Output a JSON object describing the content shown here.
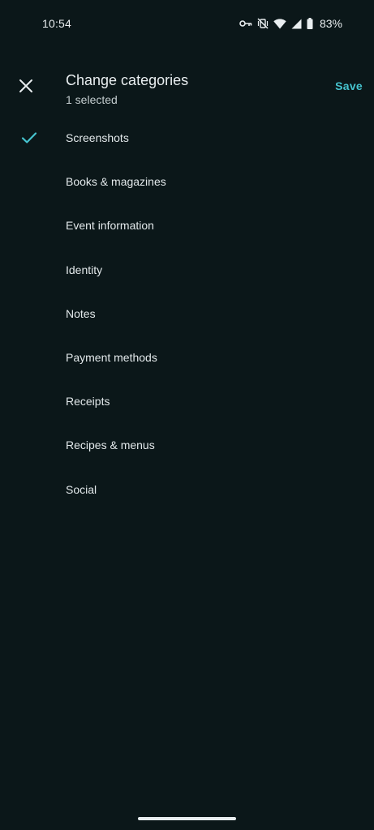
{
  "status_bar": {
    "time": "10:54",
    "battery_percent": "83%",
    "icons": [
      "key-icon",
      "vibrate-off-icon",
      "wifi-icon",
      "signal-icon",
      "battery-icon"
    ]
  },
  "header": {
    "close_icon": "close-icon",
    "title": "Change categories",
    "subtitle": "1 selected",
    "save_label": "Save"
  },
  "categories": [
    {
      "label": "Screenshots",
      "selected": true
    },
    {
      "label": "Books & magazines",
      "selected": false
    },
    {
      "label": "Event information",
      "selected": false
    },
    {
      "label": "Identity",
      "selected": false
    },
    {
      "label": "Notes",
      "selected": false
    },
    {
      "label": "Payment methods",
      "selected": false
    },
    {
      "label": "Receipts",
      "selected": false
    },
    {
      "label": "Recipes & menus",
      "selected": false
    },
    {
      "label": "Social",
      "selected": false
    }
  ],
  "colors": {
    "background": "#0b1719",
    "accent": "#46c4cf",
    "text": "#e6ecec"
  }
}
